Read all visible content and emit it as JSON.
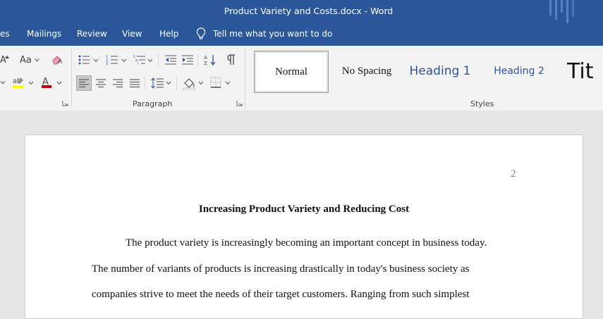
{
  "window": {
    "title": "Product Variety and Costs.docx  -  Word"
  },
  "menu": {
    "items": [
      "es",
      "Mailings",
      "Review",
      "View",
      "Help"
    ],
    "tell_me": "Tell me what you want to do"
  },
  "ribbon": {
    "font_group": {
      "grow_font": "A",
      "change_case": "Aa"
    },
    "groups": {
      "paragraph": "Paragraph",
      "styles": "Styles"
    },
    "styles": [
      "Normal",
      "No Spacing",
      "Heading 1",
      "Heading 2",
      "Tit"
    ]
  },
  "document": {
    "page_number": "2",
    "title": "Increasing Product Variety and Reducing Cost",
    "lines": [
      "The product variety is increasingly becoming an important concept in business today.",
      "The number of variants of products is increasing drastically in today's business society as",
      "companies strive to meet the needs of their target customers. Ranging from such simplest"
    ]
  },
  "colors": {
    "accent": "#2b579a",
    "heading": "#2f5496",
    "highlight": "#ffff00",
    "font_color": "#c00000"
  }
}
